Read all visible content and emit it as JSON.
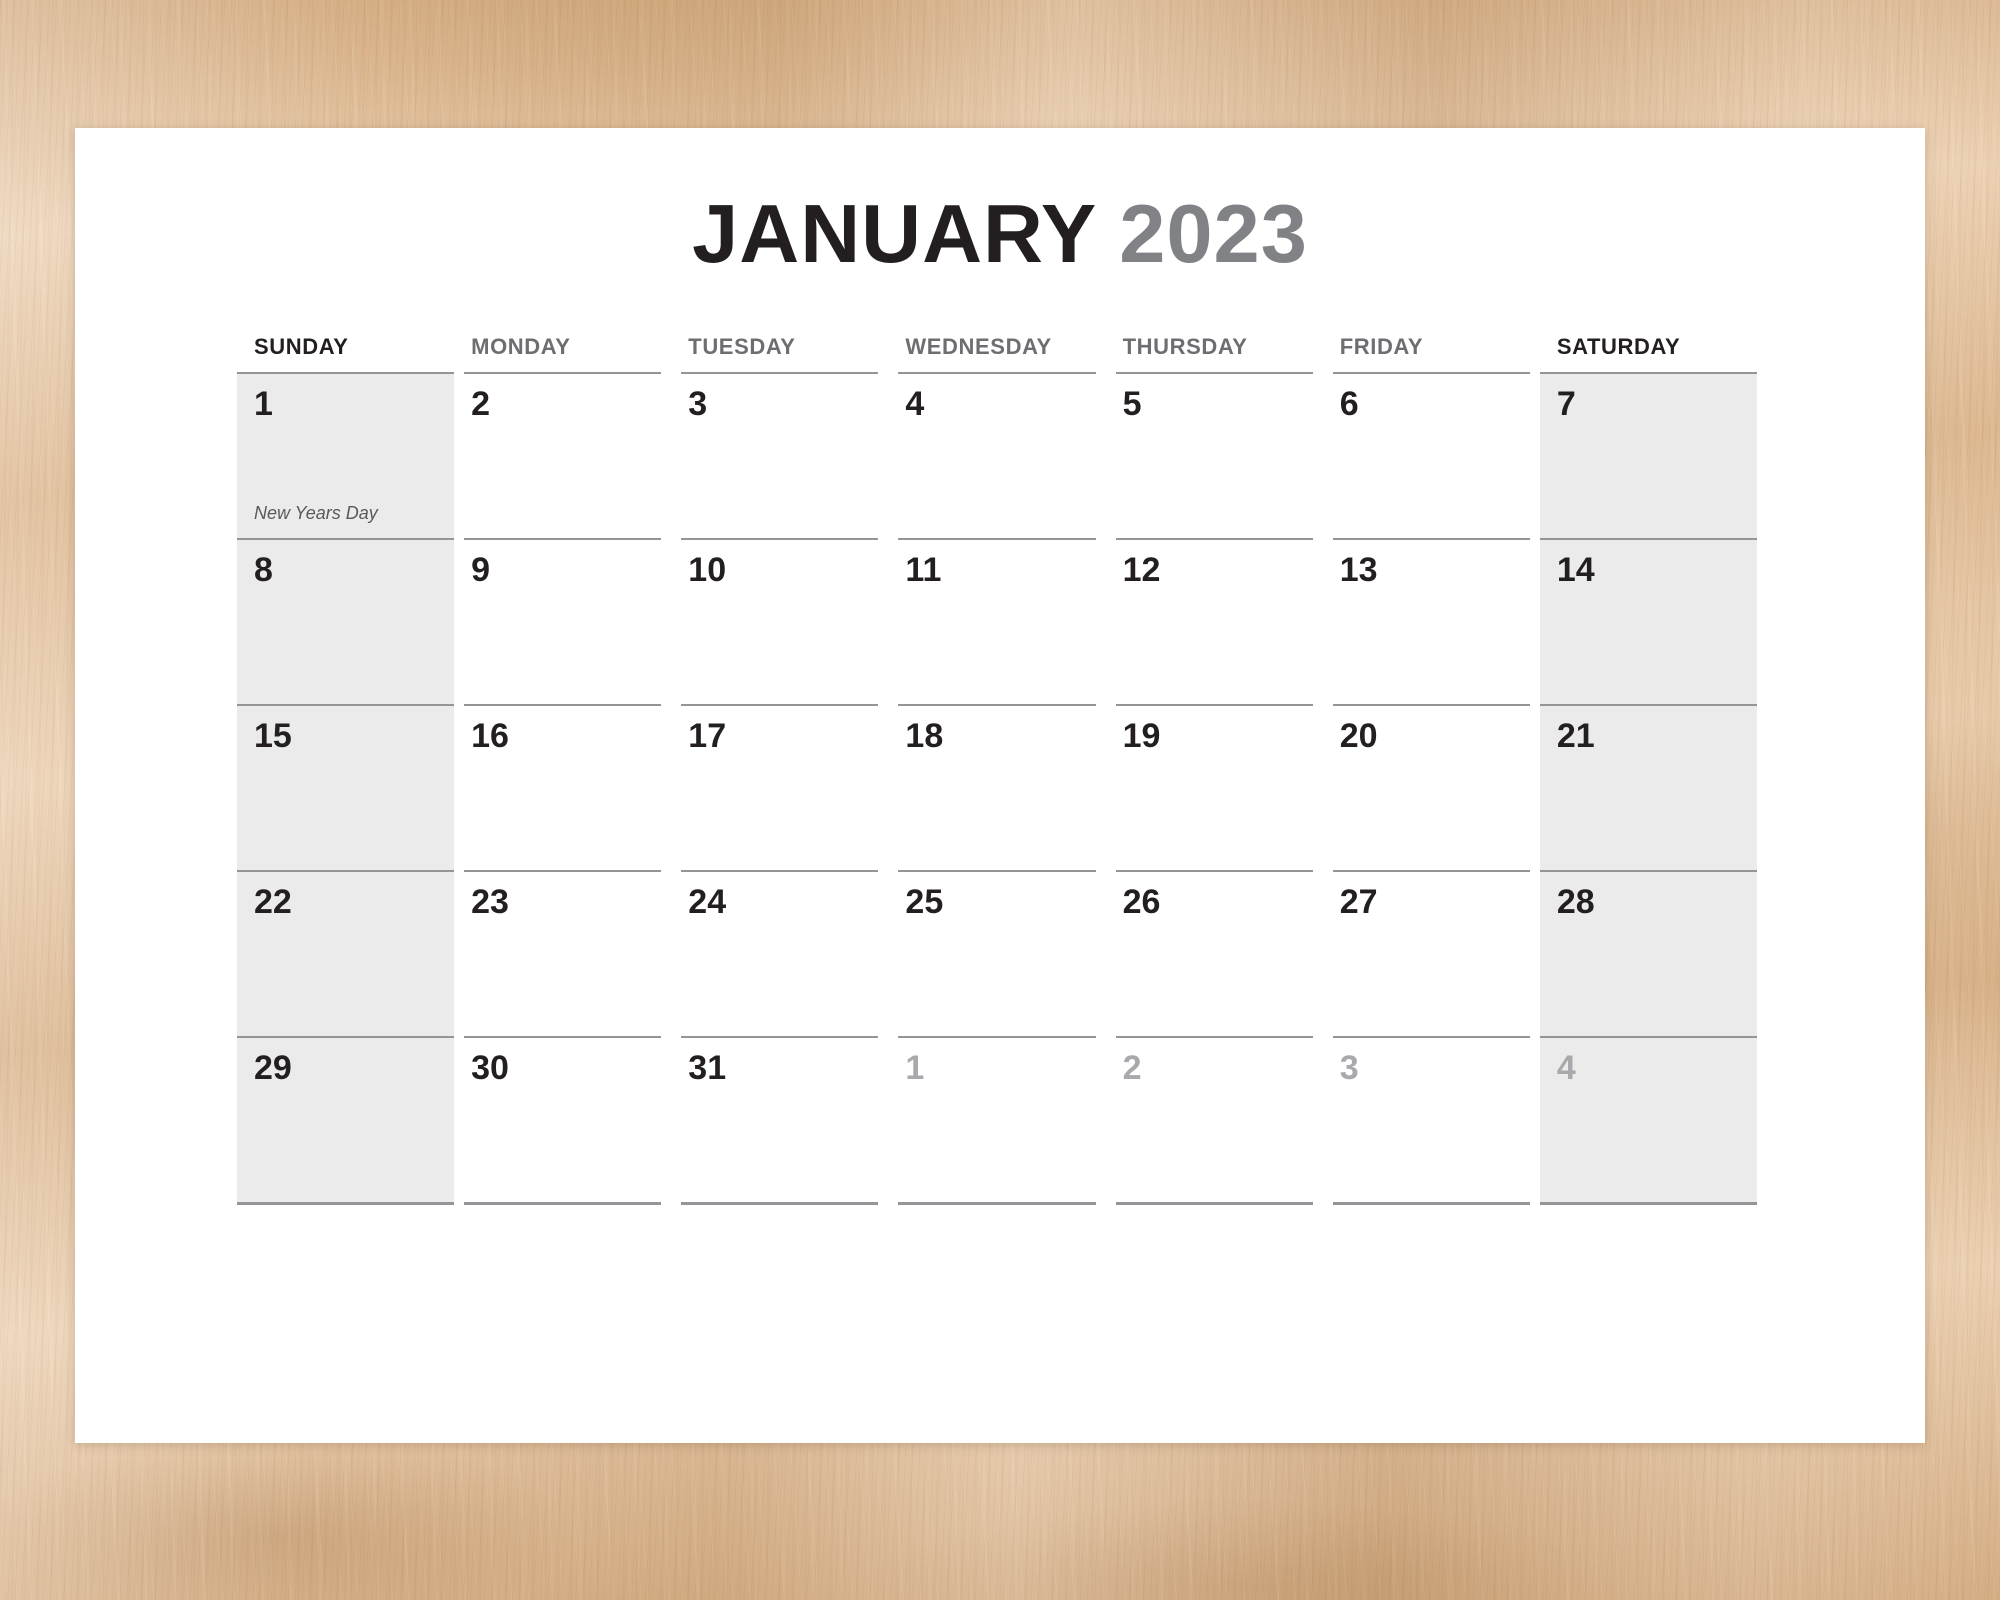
{
  "background": {
    "surface": "wood-desk",
    "wood_color": "#e3c19c"
  },
  "page": {
    "background_color": "#ffffff"
  },
  "title": {
    "month": "JANUARY",
    "year": "2023",
    "month_color": "#231f20",
    "year_color": "#808285"
  },
  "weekday_headers": [
    {
      "label": "SUNDAY",
      "weekend": true
    },
    {
      "label": "MONDAY",
      "weekend": false
    },
    {
      "label": "TUESDAY",
      "weekend": false
    },
    {
      "label": "WEDNESDAY",
      "weekend": false
    },
    {
      "label": "THURSDAY",
      "weekend": false
    },
    {
      "label": "FRIDAY",
      "weekend": false
    },
    {
      "label": "SATURDAY",
      "weekend": true
    }
  ],
  "weeks": [
    [
      {
        "day": "1",
        "muted": false,
        "shaded": true,
        "event": "New Years Day"
      },
      {
        "day": "2",
        "muted": false,
        "shaded": false,
        "event": ""
      },
      {
        "day": "3",
        "muted": false,
        "shaded": false,
        "event": ""
      },
      {
        "day": "4",
        "muted": false,
        "shaded": false,
        "event": ""
      },
      {
        "day": "5",
        "muted": false,
        "shaded": false,
        "event": ""
      },
      {
        "day": "6",
        "muted": false,
        "shaded": false,
        "event": ""
      },
      {
        "day": "7",
        "muted": false,
        "shaded": true,
        "event": ""
      }
    ],
    [
      {
        "day": "8",
        "muted": false,
        "shaded": true,
        "event": ""
      },
      {
        "day": "9",
        "muted": false,
        "shaded": false,
        "event": ""
      },
      {
        "day": "10",
        "muted": false,
        "shaded": false,
        "event": ""
      },
      {
        "day": "11",
        "muted": false,
        "shaded": false,
        "event": ""
      },
      {
        "day": "12",
        "muted": false,
        "shaded": false,
        "event": ""
      },
      {
        "day": "13",
        "muted": false,
        "shaded": false,
        "event": ""
      },
      {
        "day": "14",
        "muted": false,
        "shaded": true,
        "event": ""
      }
    ],
    [
      {
        "day": "15",
        "muted": false,
        "shaded": true,
        "event": ""
      },
      {
        "day": "16",
        "muted": false,
        "shaded": false,
        "event": ""
      },
      {
        "day": "17",
        "muted": false,
        "shaded": false,
        "event": ""
      },
      {
        "day": "18",
        "muted": false,
        "shaded": false,
        "event": ""
      },
      {
        "day": "19",
        "muted": false,
        "shaded": false,
        "event": ""
      },
      {
        "day": "20",
        "muted": false,
        "shaded": false,
        "event": ""
      },
      {
        "day": "21",
        "muted": false,
        "shaded": true,
        "event": ""
      }
    ],
    [
      {
        "day": "22",
        "muted": false,
        "shaded": true,
        "event": ""
      },
      {
        "day": "23",
        "muted": false,
        "shaded": false,
        "event": ""
      },
      {
        "day": "24",
        "muted": false,
        "shaded": false,
        "event": ""
      },
      {
        "day": "25",
        "muted": false,
        "shaded": false,
        "event": ""
      },
      {
        "day": "26",
        "muted": false,
        "shaded": false,
        "event": ""
      },
      {
        "day": "27",
        "muted": false,
        "shaded": false,
        "event": ""
      },
      {
        "day": "28",
        "muted": false,
        "shaded": true,
        "event": ""
      }
    ],
    [
      {
        "day": "29",
        "muted": false,
        "shaded": true,
        "event": ""
      },
      {
        "day": "30",
        "muted": false,
        "shaded": false,
        "event": ""
      },
      {
        "day": "31",
        "muted": false,
        "shaded": false,
        "event": ""
      },
      {
        "day": "1",
        "muted": true,
        "shaded": false,
        "event": ""
      },
      {
        "day": "2",
        "muted": true,
        "shaded": false,
        "event": ""
      },
      {
        "day": "3",
        "muted": true,
        "shaded": false,
        "event": ""
      },
      {
        "day": "4",
        "muted": true,
        "shaded": true,
        "event": ""
      }
    ]
  ]
}
